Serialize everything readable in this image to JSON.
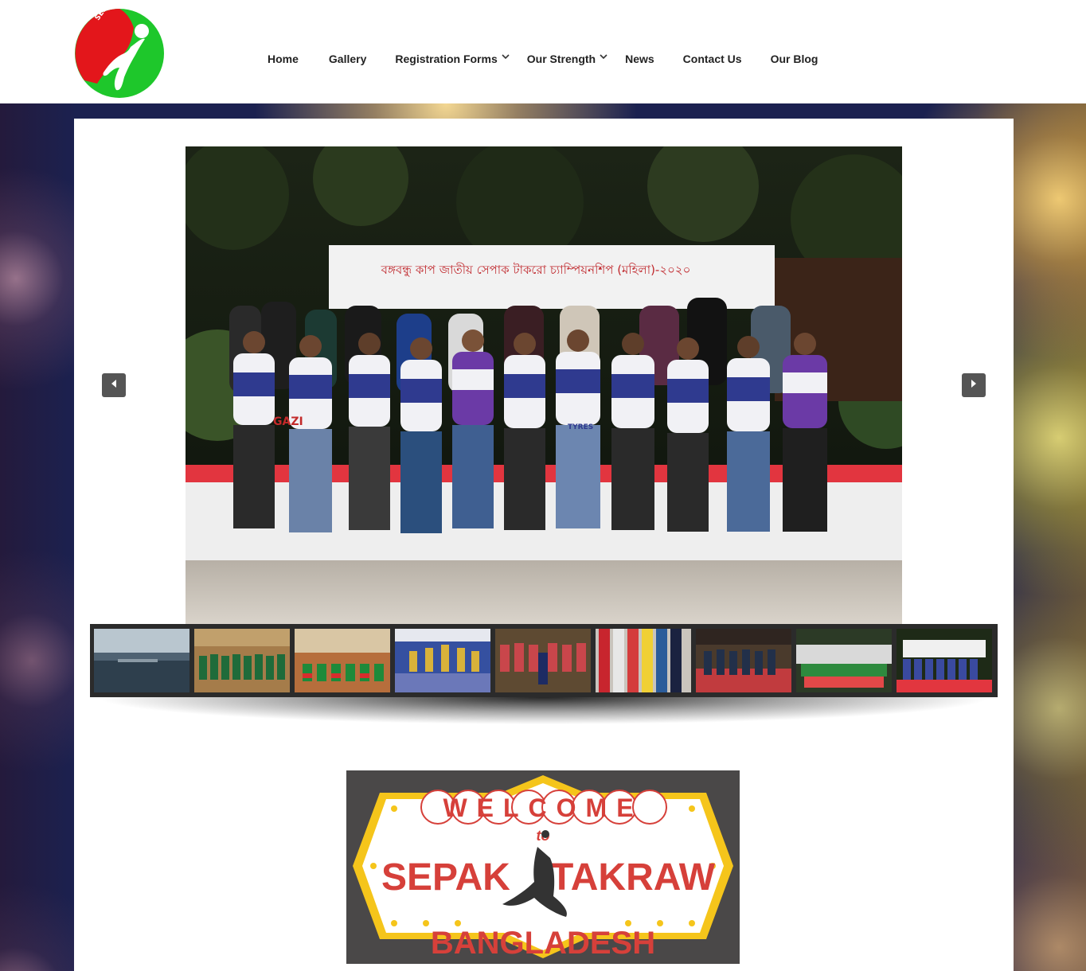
{
  "header": {
    "logo_text": "SEPAK TAKRAW BANGLADESH",
    "nav": [
      {
        "label": "Home",
        "dropdown": false
      },
      {
        "label": "Gallery",
        "dropdown": false
      },
      {
        "label": "Registration Forms",
        "dropdown": true
      },
      {
        "label": "Our Strength",
        "dropdown": true
      },
      {
        "label": "News",
        "dropdown": false
      },
      {
        "label": "Contact Us",
        "dropdown": false
      },
      {
        "label": "Our Blog",
        "dropdown": false
      }
    ]
  },
  "slider": {
    "banner_text": "বঙ্গবন্ধু কাপ জাতীয় সেপাক টাকরো চ্যাম্পিয়নশিপ (মহিলা)-২০২০",
    "jersey_text": "GAZI",
    "jersey_subtext": "TYRES",
    "prev_icon": "arrow-left-icon",
    "next_icon": "arrow-right-icon",
    "thumbnail_count": 9
  },
  "welcome": {
    "line1": "WELCOME",
    "line2": "to",
    "line3_left": "SEPAK",
    "line3_right": "TAKRAW",
    "line4": "BANGLADESH"
  },
  "colors": {
    "logo_red": "#e3161b",
    "logo_green": "#1ec72b",
    "welcome_red": "#d6403a",
    "welcome_yellow": "#f5c51b"
  }
}
